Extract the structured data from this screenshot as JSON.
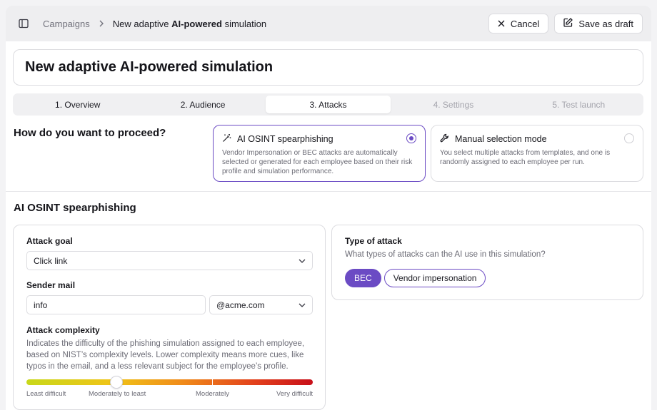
{
  "breadcrumb": {
    "root": "Campaigns",
    "current_prefix": "New adaptive ",
    "current_bold": "AI-powered",
    "current_suffix": " simulation"
  },
  "actions": {
    "cancel": "Cancel",
    "save_draft": "Save as draft"
  },
  "title": "New adaptive AI-powered simulation",
  "steps": [
    {
      "label": "1. Overview",
      "state": "done"
    },
    {
      "label": "2. Audience",
      "state": "done"
    },
    {
      "label": "3. Attacks",
      "state": "active"
    },
    {
      "label": "4. Settings",
      "state": "disabled"
    },
    {
      "label": "5. Test launch",
      "state": "disabled"
    }
  ],
  "question": "How do you want to proceed?",
  "options": [
    {
      "title": "AI OSINT spearphishing",
      "desc": "Vendor Impersonation or BEC attacks are automatically selected or generated for each employee based on their risk profile and simulation performance.",
      "selected": true,
      "icon": "magic-wand-icon"
    },
    {
      "title": "Manual selection mode",
      "desc": "You select multiple attacks from templates, and one is randomly assigned to each employee per run.",
      "selected": false,
      "icon": "wrench-icon"
    }
  ],
  "section_title": "AI OSINT spearphishing",
  "attack_goal": {
    "label": "Attack goal",
    "value": "Click link"
  },
  "sender_mail": {
    "label": "Sender mail",
    "local": "info",
    "domain": "@acme.com"
  },
  "complexity": {
    "label": "Attack complexity",
    "desc": "Indicates the difficulty of the phishing simulation assigned to each employee, based on NIST’s complexity levels. Lower complexity means more cues, like typos in the email, and a less relevant subject for the employee’s profile.",
    "level": 0.315,
    "labels": [
      "Least difficult",
      "Moderately to least",
      "Moderately",
      "Very difficult"
    ]
  },
  "attack_type": {
    "title": "Type of attack",
    "subtitle": "What types of attacks can the AI use in this simulation?",
    "chips": [
      {
        "label": "BEC",
        "active": true
      },
      {
        "label": "Vendor impersonation",
        "active": false
      }
    ]
  },
  "colors": {
    "accent": "#6b4bc4"
  }
}
